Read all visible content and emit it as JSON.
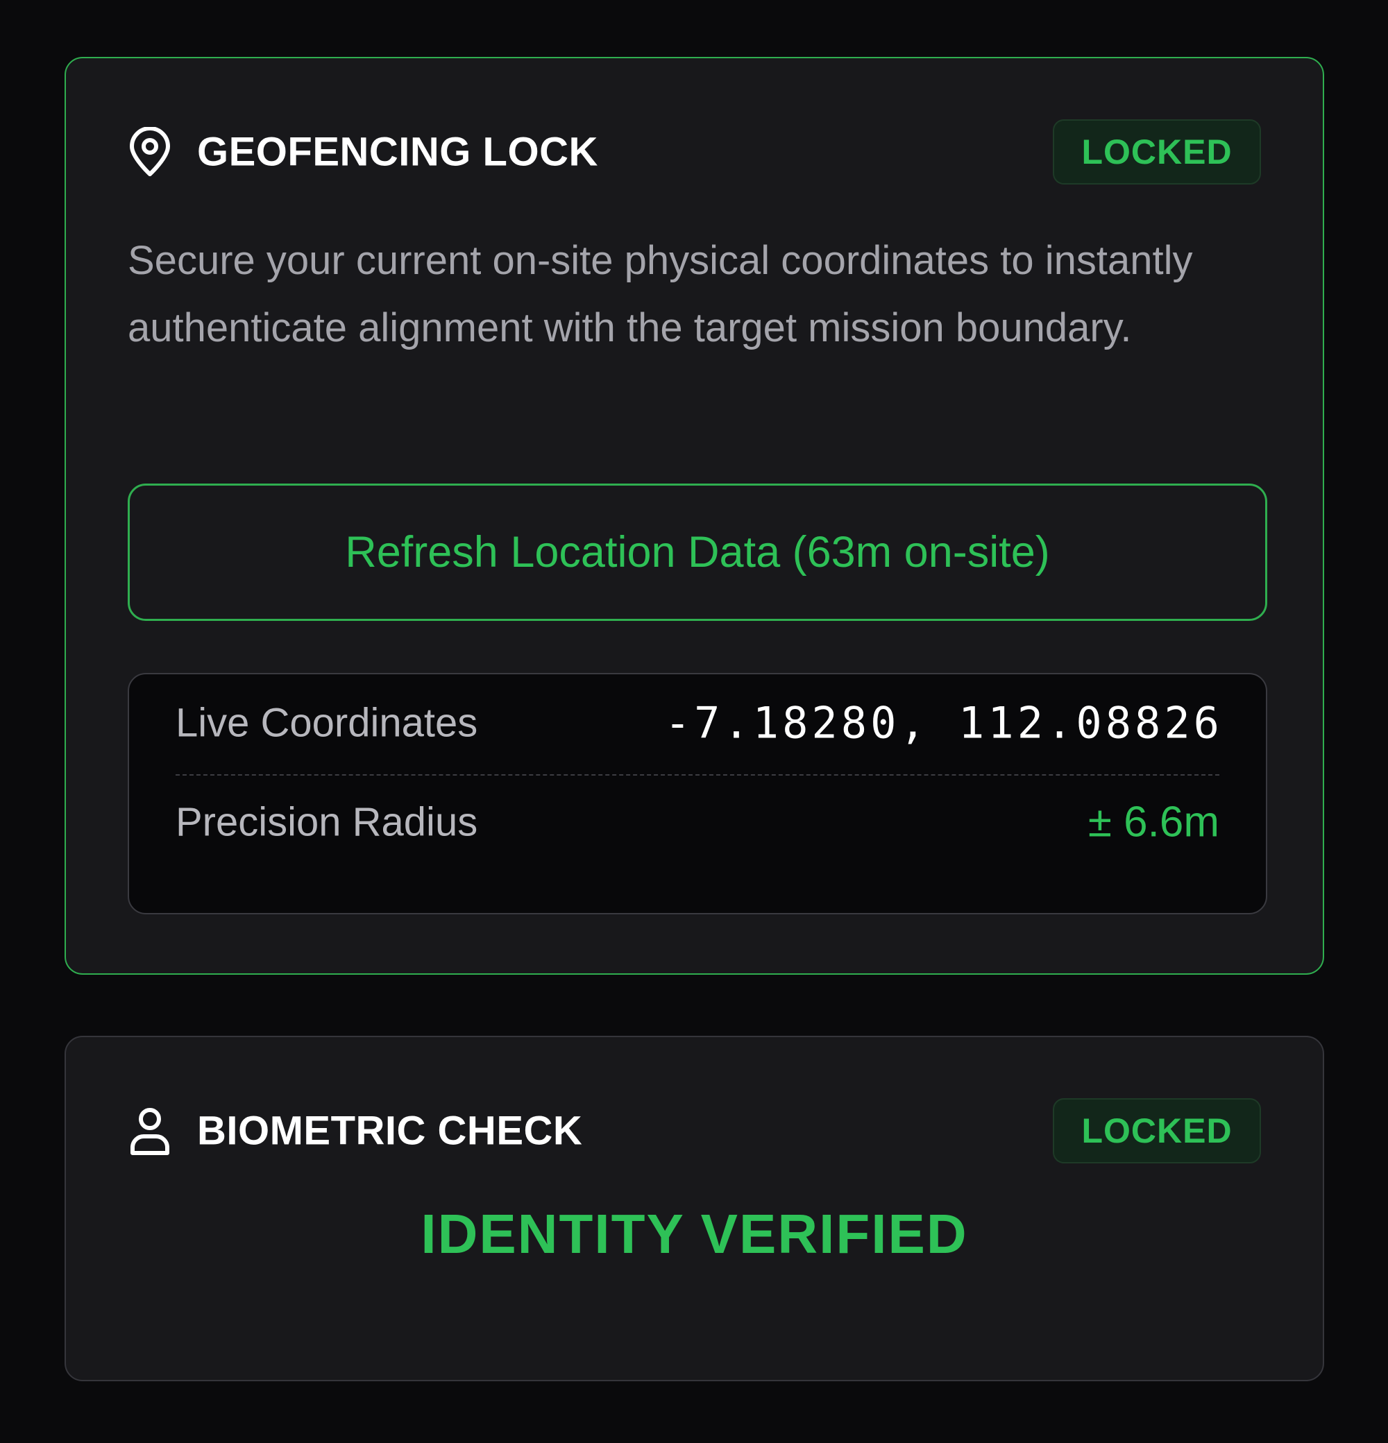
{
  "colors": {
    "background": "#0a0a0c",
    "card": "#18181b",
    "accent_green": "#2ec157",
    "card_border_active": "#2fae4f",
    "card_border_neutral": "#35353b",
    "muted_text": "#a4a4ab"
  },
  "geofencing": {
    "icon": "map-pin-icon",
    "title": "GEOFENCING LOCK",
    "status": "LOCKED",
    "description": "Secure your current on-site physical coordinates to instantly authenticate alignment with the target mission boundary.",
    "refresh_button_label": "Refresh Location Data (63m on-site)",
    "coordinates_label": "Live Coordinates",
    "coordinates_value": "-7.18280, 112.08826",
    "precision_label": "Precision Radius",
    "precision_value": "± 6.6m"
  },
  "biometric": {
    "icon": "user-icon",
    "title": "BIOMETRIC CHECK",
    "status": "LOCKED",
    "result": "IDENTITY VERIFIED"
  }
}
